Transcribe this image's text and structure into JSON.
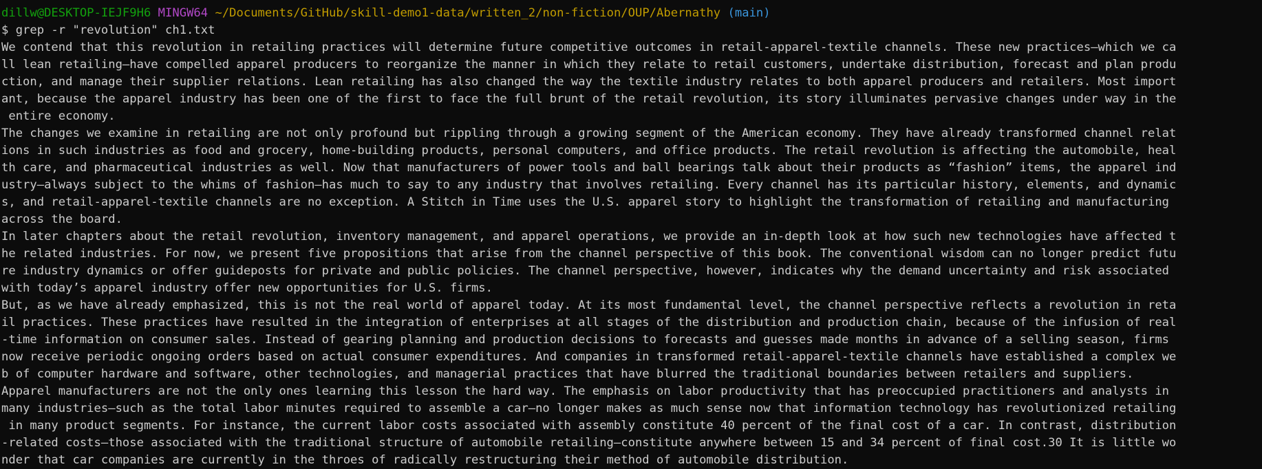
{
  "prompt": {
    "user_host": "dillw@DESKTOP-IEJF9H6",
    "shell": "MINGW64",
    "path": "~/Documents/GitHub/skill-demo1-data/written_2/non-fiction/OUP/Abernathy",
    "branch": "(main)",
    "command": "$ grep -r \"revolution\" ch1.txt"
  },
  "output_lines": [
    "We contend that this revolution in retailing practices will determine future competitive outcomes in retail-apparel-textile channels. These new practices—which we ca",
    "ll lean retailing—have compelled apparel producers to reorganize the manner in which they relate to retail customers, undertake distribution, forecast and plan produ",
    "ction, and manage their supplier relations. Lean retailing has also changed the way the textile industry relates to both apparel producers and retailers. Most import",
    "ant, because the apparel industry has been one of the first to face the full brunt of the retail revolution, its story illuminates pervasive changes under way in the",
    " entire economy.",
    "The changes we examine in retailing are not only profound but rippling through a growing segment of the American economy. They have already transformed channel relat",
    "ions in such industries as food and grocery, home-building products, personal computers, and office products. The retail revolution is affecting the automobile, heal",
    "th care, and pharmaceutical industries as well. Now that manufacturers of power tools and ball bearings talk about their products as “fashion” items, the apparel ind",
    "ustry—always subject to the whims of fashion—has much to say to any industry that involves retailing. Every channel has its particular history, elements, and dynamic",
    "s, and retail-apparel-textile channels are no exception. A Stitch in Time uses the U.S. apparel story to highlight the transformation of retailing and manufacturing",
    "across the board.",
    "In later chapters about the retail revolution, inventory management, and apparel operations, we provide an in-depth look at how such new technologies have affected t",
    "he related industries. For now, we present five propositions that arise from the channel perspective of this book. The conventional wisdom can no longer predict futu",
    "re industry dynamics or offer guideposts for private and public policies. The channel perspective, however, indicates why the demand uncertainty and risk associated",
    "with today’s apparel industry offer new opportunities for U.S. firms.",
    "But, as we have already emphasized, this is not the real world of apparel today. At its most fundamental level, the channel perspective reflects a revolution in reta",
    "il practices. These practices have resulted in the integration of enterprises at all stages of the distribution and production chain, because of the infusion of real",
    "-time information on consumer sales. Instead of gearing planning and production decisions to forecasts and guesses made months in advance of a selling season, firms",
    "now receive periodic ongoing orders based on actual consumer expenditures. And companies in transformed retail-apparel-textile channels have established a complex we",
    "b of computer hardware and software, other technologies, and managerial practices that have blurred the traditional boundaries between retailers and suppliers.",
    "Apparel manufacturers are not the only ones learning this lesson the hard way. The emphasis on labor productivity that has preoccupied practitioners and analysts in",
    "many industries—such as the total labor minutes required to assemble a car—no longer makes as much sense now that information technology has revolutionized retailing",
    " in many product segments. For instance, the current labor costs associated with assembly constitute 40 percent of the final cost of a car. In contrast, distribution",
    "-related costs—those associated with the traditional structure of automobile retailing—constitute anywhere between 15 and 34 percent of final cost.30 It is little wo",
    "nder that car companies are currently in the throes of radically restructuring their method of automobile distribution."
  ],
  "colors": {
    "background": "#0c0c0c",
    "text": "#cccccc",
    "user_host": "#13a10e",
    "shell": "#b148c6",
    "path": "#c19c00",
    "branch": "#3a96dd"
  }
}
